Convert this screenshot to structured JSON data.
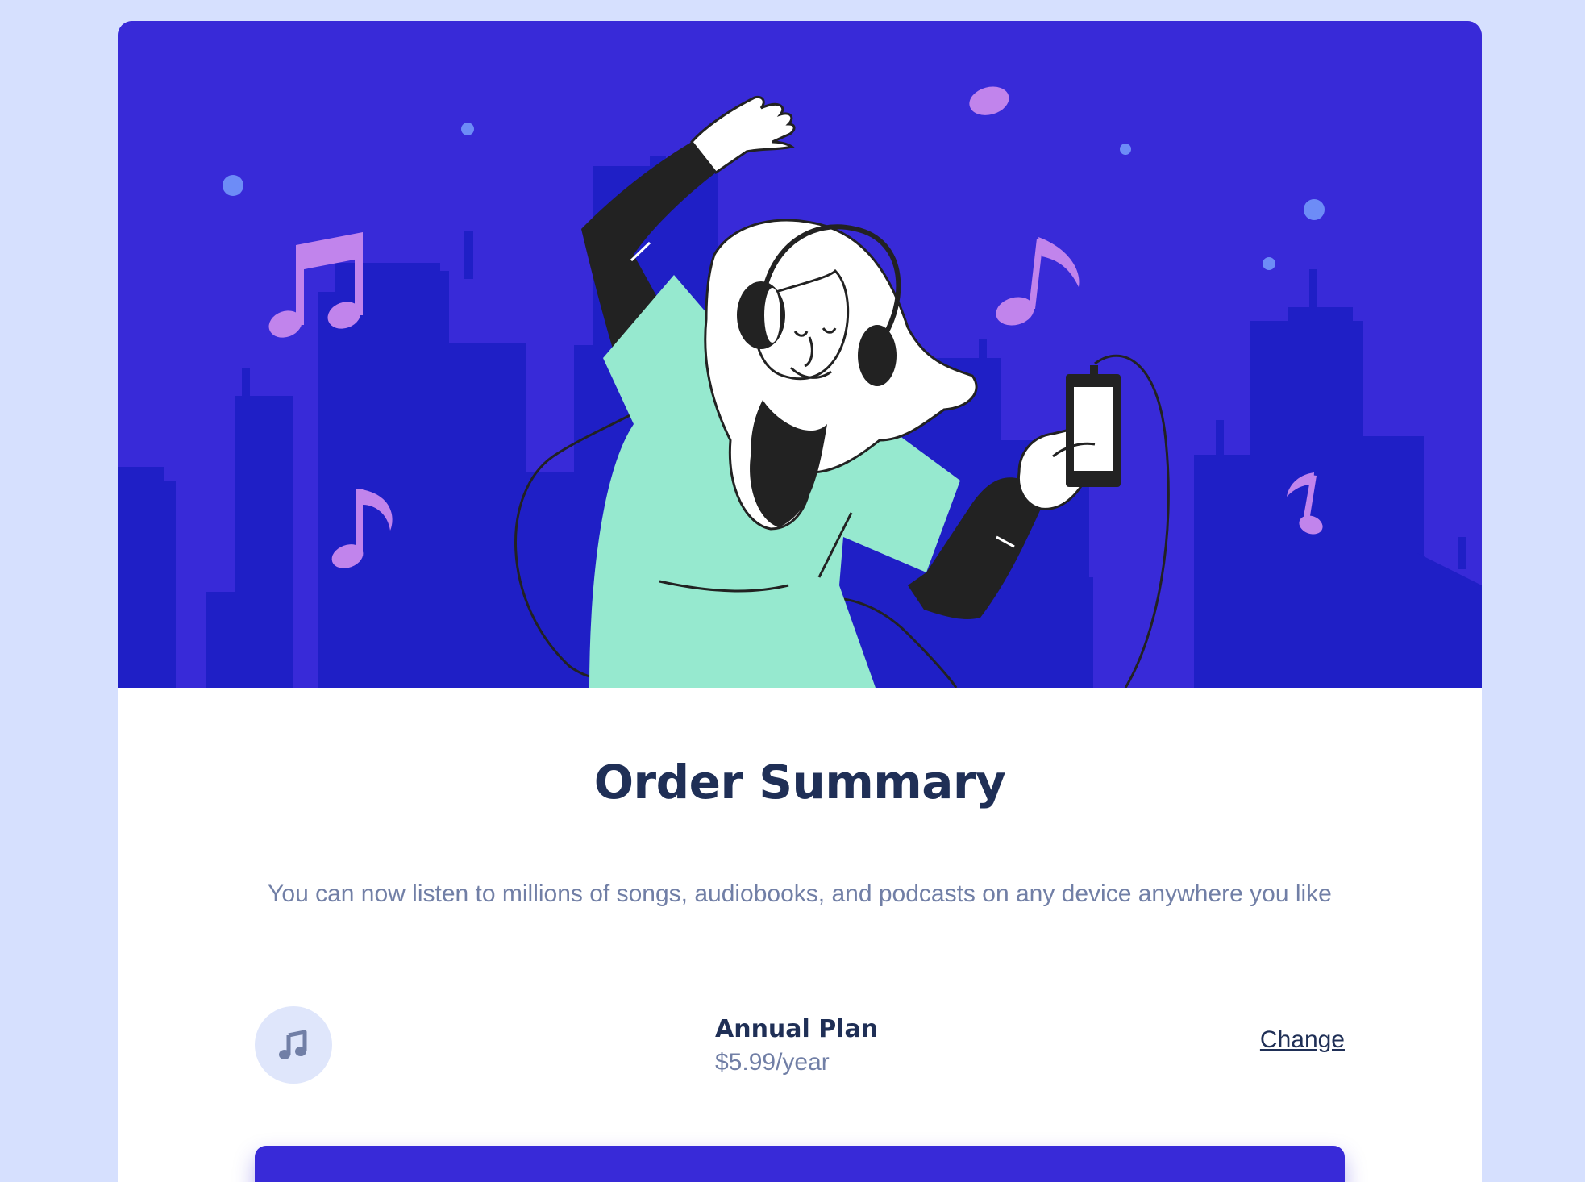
{
  "page": {
    "background_color": "#D6E0FE"
  },
  "hero": {
    "colors": {
      "sky": "#382AD8",
      "buildings": "#1F1FC6",
      "stars": "#6D8CF7",
      "notes": "#C184EC",
      "shirt": "#96E9CF",
      "sleeves": "#222222"
    }
  },
  "summary": {
    "title": "Order Summary",
    "description": "You can now listen to millions of songs, audiobooks, and podcasts on any device anywhere you like"
  },
  "plan": {
    "icon": "music-note-icon",
    "name": "Annual Plan",
    "price": "$5.99/year",
    "change_label": "Change"
  },
  "colors": {
    "accent": "#382AD8",
    "heading": "#1F2F56",
    "muted": "#717FA6",
    "icon_bg": "#DFE6FB"
  }
}
